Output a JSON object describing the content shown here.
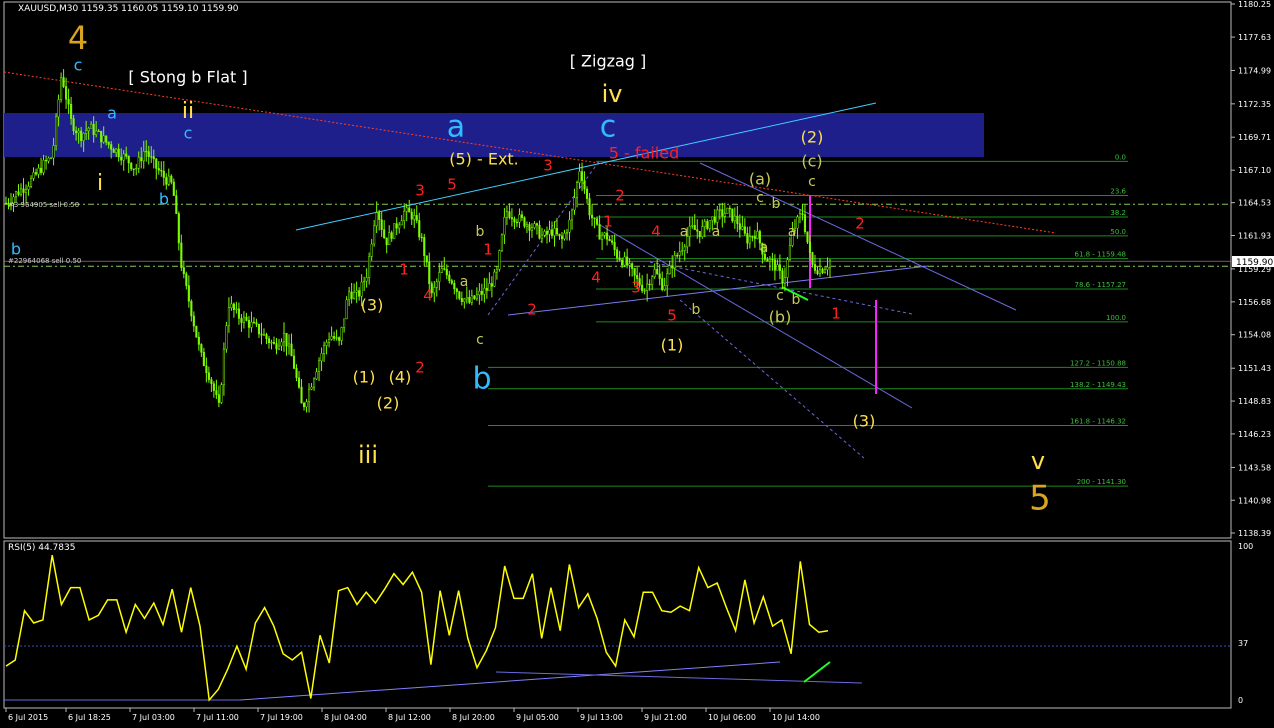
{
  "header": {
    "symbol_line": "XAUUSD,M30  1159.35 1160.05 1159.10 1159.90",
    "sell_line_1": "#3  964905 sell 0.50",
    "sell_line_2": "#22964068 sell 0.50"
  },
  "colors": {
    "candle": "#7CFC00",
    "rsi_line": "#FFFF00",
    "wave_red": "#FF2020",
    "wave_yellow": "#FFE14D",
    "wave_blue": "#33BBFF",
    "wave_olive": "#C8C85A",
    "wave_orange": "#D9A520",
    "band": "#1F1F8C"
  },
  "chart_data": [
    {
      "type": "candlestick",
      "symbol": "XAUUSD",
      "timeframe": "M30",
      "ohlc_current": {
        "open": 1159.35,
        "high": 1160.05,
        "low": 1159.1,
        "close": 1159.9
      },
      "ylim": [
        1138.39,
        1180.25
      ],
      "y_ticks": [
        "1180.25",
        "1177.63",
        "1174.99",
        "1172.35",
        "1169.71",
        "1167.10",
        "1164.53",
        "1161.93",
        "1159.29",
        "1156.68",
        "1154.08",
        "1151.43",
        "1148.83",
        "1146.23",
        "1143.58",
        "1140.98",
        "1138.39"
      ],
      "current_price_label": "1159.90",
      "x_ticks": [
        "6 Jul 2015",
        "6 Jul 18:25",
        "7 Jul 03:00",
        "7 Jul 11:00",
        "7 Jul 19:00",
        "8 Jul 04:00",
        "8 Jul 12:00",
        "8 Jul 20:00",
        "9 Jul 05:00",
        "9 Jul 13:00",
        "9 Jul 21:00",
        "10 Jul 06:00",
        "10 Jul 14:00"
      ],
      "close_path": [
        1164.5,
        1165.2,
        1165.8,
        1166.5,
        1167.5,
        1168.2,
        1174.8,
        1171.0,
        1169.8,
        1170.5,
        1169.9,
        1169.2,
        1168.6,
        1168.0,
        1167.2,
        1168.8,
        1167.5,
        1166.6,
        1165.9,
        1159.2,
        1156.0,
        1152.5,
        1150.8,
        1148.3,
        1156.6,
        1155.6,
        1155.1,
        1154.6,
        1153.9,
        1153.2,
        1154.1,
        1152.0,
        1148.2,
        1150.3,
        1152.5,
        1154.1,
        1153.4,
        1157.5,
        1157.1,
        1159.0,
        1164.3,
        1161.4,
        1162.5,
        1163.8,
        1163.5,
        1161.3,
        1157.1,
        1159.2,
        1158.6,
        1157.2,
        1156.6,
        1157.2,
        1157.7,
        1158.9,
        1163.9,
        1163.4,
        1163.0,
        1162.6,
        1161.8,
        1162.3,
        1161.5,
        1163.2,
        1167.4,
        1163.9,
        1162.1,
        1161.8,
        1160.4,
        1159.7,
        1158.5,
        1157.7,
        1159.2,
        1157.9,
        1159.8,
        1161.0,
        1162.5,
        1162.2,
        1163.1,
        1163.6,
        1163.8,
        1163.0,
        1161.6,
        1162.2,
        1160.2,
        1159.6,
        1158.3,
        1162.3,
        1163.8,
        1159.6,
        1159.2,
        1159.9
      ],
      "sell_lines_price": [
        1164.4,
        1159.5
      ],
      "fib_levels": [
        {
          "label": "0.0",
          "price": 1167.8
        },
        {
          "label": "23.6",
          "price": 1165.1
        },
        {
          "label": "38.2",
          "price": 1163.4
        },
        {
          "label": "50.0",
          "price": 1161.9
        },
        {
          "label": "61.8 - 1159.48",
          "price": 1160.1
        },
        {
          "label": "78.6 - 1157.27",
          "price": 1157.7
        },
        {
          "label": "100.0",
          "price": 1155.1
        },
        {
          "label": "127.2 - 1150.88",
          "price": 1151.5
        },
        {
          "label": "138.2 - 1149.43",
          "price": 1149.8
        },
        {
          "label": "161.8 - 1146.32",
          "price": 1146.9
        },
        {
          "label": "200 - 1141.30",
          "price": 1142.1
        }
      ],
      "annotations": [
        {
          "text": "4",
          "color": "#D9A520",
          "size": 32,
          "x": 78,
          "y": 40
        },
        {
          "text": "c",
          "color": "#33BBFF",
          "size": 16,
          "x": 78,
          "y": 66
        },
        {
          "text": "[ Stong b Flat ]",
          "color": "#FFFFFF",
          "size": 16,
          "x": 188,
          "y": 78
        },
        {
          "text": "ii",
          "color": "#FFE14D",
          "size": 22,
          "x": 188,
          "y": 112
        },
        {
          "text": "c",
          "color": "#33BBFF",
          "size": 16,
          "x": 188,
          "y": 134
        },
        {
          "text": "a",
          "color": "#33BBFF",
          "size": 16,
          "x": 112,
          "y": 114
        },
        {
          "text": "i",
          "color": "#FFE14D",
          "size": 22,
          "x": 100,
          "y": 184
        },
        {
          "text": "b",
          "color": "#33BBFF",
          "size": 16,
          "x": 164,
          "y": 200
        },
        {
          "text": "b",
          "color": "#33BBFF",
          "size": 16,
          "x": 16,
          "y": 250
        },
        {
          "text": "a",
          "color": "#33BBFF",
          "size": 30,
          "x": 456,
          "y": 128
        },
        {
          "text": "[ Zigzag ]",
          "color": "#FFFFFF",
          "size": 16,
          "x": 608,
          "y": 62
        },
        {
          "text": "iv",
          "color": "#FFE14D",
          "size": 24,
          "x": 612,
          "y": 95
        },
        {
          "text": "c",
          "color": "#33BBFF",
          "size": 30,
          "x": 608,
          "y": 128
        },
        {
          "text": "5 - failed",
          "color": "#FF2020",
          "size": 16,
          "x": 644,
          "y": 154
        },
        {
          "text": "(5) - Ext.",
          "color": "#FFE14D",
          "size": 16,
          "x": 484,
          "y": 160
        },
        {
          "text": "3",
          "color": "#FF2020",
          "size": 15,
          "x": 420,
          "y": 191
        },
        {
          "text": "5",
          "color": "#FF2020",
          "size": 15,
          "x": 452,
          "y": 185
        },
        {
          "text": "3",
          "color": "#FF2020",
          "size": 15,
          "x": 548,
          "y": 166
        },
        {
          "text": "2",
          "color": "#FF2020",
          "size": 15,
          "x": 620,
          "y": 196
        },
        {
          "text": "1",
          "color": "#FF2020",
          "size": 15,
          "x": 608,
          "y": 222
        },
        {
          "text": "4",
          "color": "#FF2020",
          "size": 15,
          "x": 656,
          "y": 232
        },
        {
          "text": "b",
          "color": "#C8C85A",
          "size": 14,
          "x": 480,
          "y": 232
        },
        {
          "text": "1",
          "color": "#FF2020",
          "size": 15,
          "x": 488,
          "y": 250
        },
        {
          "text": "1",
          "color": "#FF2020",
          "size": 15,
          "x": 404,
          "y": 270
        },
        {
          "text": "a",
          "color": "#C8C85A",
          "size": 14,
          "x": 464,
          "y": 282
        },
        {
          "text": "4",
          "color": "#FF2020",
          "size": 15,
          "x": 428,
          "y": 296
        },
        {
          "text": "(3)",
          "color": "#FFE14D",
          "size": 16,
          "x": 372,
          "y": 306
        },
        {
          "text": "2",
          "color": "#FF2020",
          "size": 15,
          "x": 532,
          "y": 310
        },
        {
          "text": "c",
          "color": "#C8C85A",
          "size": 14,
          "x": 480,
          "y": 340
        },
        {
          "text": "b",
          "color": "#33BBFF",
          "size": 30,
          "x": 482,
          "y": 380
        },
        {
          "text": "(1)",
          "color": "#FFE14D",
          "size": 16,
          "x": 364,
          "y": 378
        },
        {
          "text": "(4)",
          "color": "#FFE14D",
          "size": 16,
          "x": 400,
          "y": 378
        },
        {
          "text": "2",
          "color": "#FF2020",
          "size": 15,
          "x": 420,
          "y": 368
        },
        {
          "text": "(2)",
          "color": "#FFE14D",
          "size": 16,
          "x": 388,
          "y": 404
        },
        {
          "text": "iii",
          "color": "#FFE14D",
          "size": 24,
          "x": 368,
          "y": 456
        },
        {
          "text": "4",
          "color": "#FF2020",
          "size": 15,
          "x": 596,
          "y": 278
        },
        {
          "text": "3",
          "color": "#FF2020",
          "size": 15,
          "x": 636,
          "y": 288
        },
        {
          "text": "a",
          "color": "#C8C85A",
          "size": 14,
          "x": 684,
          "y": 232
        },
        {
          "text": "5",
          "color": "#FF2020",
          "size": 15,
          "x": 672,
          "y": 316
        },
        {
          "text": "b",
          "color": "#C8C85A",
          "size": 14,
          "x": 696,
          "y": 310
        },
        {
          "text": "(1)",
          "color": "#FFE14D",
          "size": 16,
          "x": 672,
          "y": 346
        },
        {
          "text": "(a)",
          "color": "#C8C85A",
          "size": 16,
          "x": 760,
          "y": 180
        },
        {
          "text": "c",
          "color": "#C8C85A",
          "size": 14,
          "x": 760,
          "y": 198
        },
        {
          "text": "b",
          "color": "#C8C85A",
          "size": 14,
          "x": 776,
          "y": 204
        },
        {
          "text": "a",
          "color": "#C8C85A",
          "size": 14,
          "x": 716,
          "y": 232
        },
        {
          "text": "a",
          "color": "#C8C85A",
          "size": 14,
          "x": 764,
          "y": 248
        },
        {
          "text": "a",
          "color": "#C8C85A",
          "size": 14,
          "x": 792,
          "y": 232
        },
        {
          "text": "(2)",
          "color": "#FFE14D",
          "size": 16,
          "x": 812,
          "y": 138
        },
        {
          "text": "(c)",
          "color": "#C8C85A",
          "size": 16,
          "x": 812,
          "y": 162
        },
        {
          "text": "c",
          "color": "#C8C85A",
          "size": 14,
          "x": 812,
          "y": 182
        },
        {
          "text": "2",
          "color": "#FF2020",
          "size": 15,
          "x": 860,
          "y": 224
        },
        {
          "text": "c",
          "color": "#C8C85A",
          "size": 14,
          "x": 780,
          "y": 296
        },
        {
          "text": "b",
          "color": "#C8C85A",
          "size": 14,
          "x": 796,
          "y": 300
        },
        {
          "text": "(b)",
          "color": "#C8C85A",
          "size": 16,
          "x": 780,
          "y": 318
        },
        {
          "text": "1",
          "color": "#FF2020",
          "size": 15,
          "x": 836,
          "y": 314
        },
        {
          "text": "(3)",
          "color": "#FFE14D",
          "size": 16,
          "x": 864,
          "y": 422
        },
        {
          "text": "v",
          "color": "#FFE14D",
          "size": 24,
          "x": 1038,
          "y": 462
        },
        {
          "text": "5",
          "color": "#D9A520",
          "size": 34,
          "x": 1040,
          "y": 500
        }
      ]
    },
    {
      "type": "line",
      "title": "RSI(5) 44.7835",
      "ylim": [
        0,
        100
      ],
      "y_ticks": [
        "100",
        "37",
        "0"
      ],
      "values": [
        22,
        26,
        58,
        50,
        52,
        94,
        62,
        73,
        73,
        52,
        55,
        65,
        65,
        44,
        62,
        53,
        63,
        49,
        72,
        44,
        73,
        48,
        0,
        7,
        20,
        35,
        20,
        50,
        60,
        48,
        30,
        26,
        31,
        1,
        42,
        24,
        71,
        73,
        62,
        70,
        63,
        72,
        82,
        75,
        83,
        70,
        23,
        71,
        42,
        71,
        40,
        21,
        32,
        47,
        87,
        66,
        66,
        82,
        40,
        73,
        45,
        88,
        60,
        69,
        53,
        31,
        22,
        52,
        41,
        70,
        70,
        58,
        57,
        61,
        58,
        86,
        73,
        76,
        60,
        45,
        78,
        50,
        67,
        48,
        52,
        30,
        90,
        49,
        44,
        45
      ]
    }
  ]
}
